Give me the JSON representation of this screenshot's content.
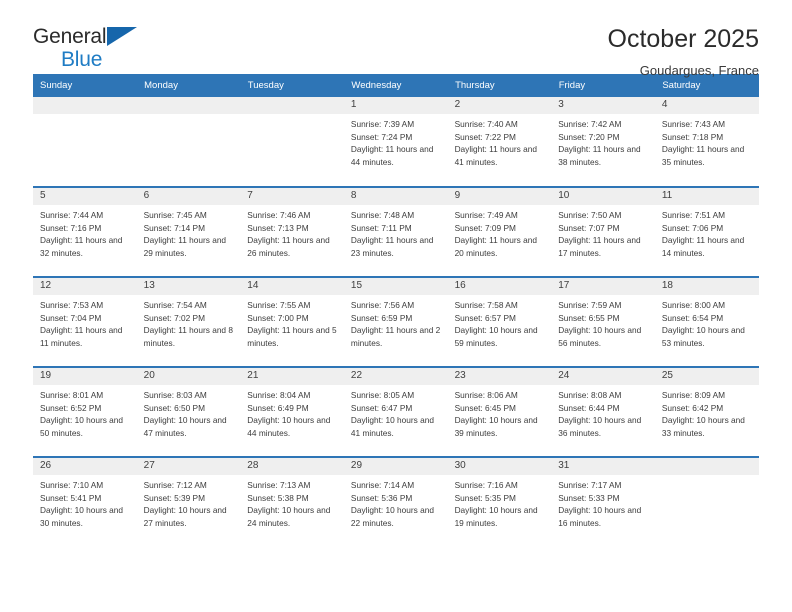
{
  "brand": {
    "name_top": "General",
    "name_bottom": "Blue",
    "triangle_icon": "triangle-icon",
    "accent_color": "#1f7cc4"
  },
  "header": {
    "title": "October 2025",
    "location": "Goudargues, France"
  },
  "theme": {
    "header_blue": "#2e75b6",
    "daynum_band": "#efefef",
    "text": "#3c3c3c"
  },
  "calendar": {
    "weekday_headers": [
      "Sunday",
      "Monday",
      "Tuesday",
      "Wednesday",
      "Thursday",
      "Friday",
      "Saturday"
    ],
    "weeks": [
      [
        {
          "day": "",
          "empty": true
        },
        {
          "day": "",
          "empty": true
        },
        {
          "day": "",
          "empty": true
        },
        {
          "day": "1",
          "sunrise": "Sunrise: 7:39 AM",
          "sunset": "Sunset: 7:24 PM",
          "daylight": "Daylight: 11 hours and 44 minutes."
        },
        {
          "day": "2",
          "sunrise": "Sunrise: 7:40 AM",
          "sunset": "Sunset: 7:22 PM",
          "daylight": "Daylight: 11 hours and 41 minutes."
        },
        {
          "day": "3",
          "sunrise": "Sunrise: 7:42 AM",
          "sunset": "Sunset: 7:20 PM",
          "daylight": "Daylight: 11 hours and 38 minutes."
        },
        {
          "day": "4",
          "sunrise": "Sunrise: 7:43 AM",
          "sunset": "Sunset: 7:18 PM",
          "daylight": "Daylight: 11 hours and 35 minutes."
        }
      ],
      [
        {
          "day": "5",
          "sunrise": "Sunrise: 7:44 AM",
          "sunset": "Sunset: 7:16 PM",
          "daylight": "Daylight: 11 hours and 32 minutes."
        },
        {
          "day": "6",
          "sunrise": "Sunrise: 7:45 AM",
          "sunset": "Sunset: 7:14 PM",
          "daylight": "Daylight: 11 hours and 29 minutes."
        },
        {
          "day": "7",
          "sunrise": "Sunrise: 7:46 AM",
          "sunset": "Sunset: 7:13 PM",
          "daylight": "Daylight: 11 hours and 26 minutes."
        },
        {
          "day": "8",
          "sunrise": "Sunrise: 7:48 AM",
          "sunset": "Sunset: 7:11 PM",
          "daylight": "Daylight: 11 hours and 23 minutes."
        },
        {
          "day": "9",
          "sunrise": "Sunrise: 7:49 AM",
          "sunset": "Sunset: 7:09 PM",
          "daylight": "Daylight: 11 hours and 20 minutes."
        },
        {
          "day": "10",
          "sunrise": "Sunrise: 7:50 AM",
          "sunset": "Sunset: 7:07 PM",
          "daylight": "Daylight: 11 hours and 17 minutes."
        },
        {
          "day": "11",
          "sunrise": "Sunrise: 7:51 AM",
          "sunset": "Sunset: 7:06 PM",
          "daylight": "Daylight: 11 hours and 14 minutes."
        }
      ],
      [
        {
          "day": "12",
          "sunrise": "Sunrise: 7:53 AM",
          "sunset": "Sunset: 7:04 PM",
          "daylight": "Daylight: 11 hours and 11 minutes."
        },
        {
          "day": "13",
          "sunrise": "Sunrise: 7:54 AM",
          "sunset": "Sunset: 7:02 PM",
          "daylight": "Daylight: 11 hours and 8 minutes."
        },
        {
          "day": "14",
          "sunrise": "Sunrise: 7:55 AM",
          "sunset": "Sunset: 7:00 PM",
          "daylight": "Daylight: 11 hours and 5 minutes."
        },
        {
          "day": "15",
          "sunrise": "Sunrise: 7:56 AM",
          "sunset": "Sunset: 6:59 PM",
          "daylight": "Daylight: 11 hours and 2 minutes."
        },
        {
          "day": "16",
          "sunrise": "Sunrise: 7:58 AM",
          "sunset": "Sunset: 6:57 PM",
          "daylight": "Daylight: 10 hours and 59 minutes."
        },
        {
          "day": "17",
          "sunrise": "Sunrise: 7:59 AM",
          "sunset": "Sunset: 6:55 PM",
          "daylight": "Daylight: 10 hours and 56 minutes."
        },
        {
          "day": "18",
          "sunrise": "Sunrise: 8:00 AM",
          "sunset": "Sunset: 6:54 PM",
          "daylight": "Daylight: 10 hours and 53 minutes."
        }
      ],
      [
        {
          "day": "19",
          "sunrise": "Sunrise: 8:01 AM",
          "sunset": "Sunset: 6:52 PM",
          "daylight": "Daylight: 10 hours and 50 minutes."
        },
        {
          "day": "20",
          "sunrise": "Sunrise: 8:03 AM",
          "sunset": "Sunset: 6:50 PM",
          "daylight": "Daylight: 10 hours and 47 minutes."
        },
        {
          "day": "21",
          "sunrise": "Sunrise: 8:04 AM",
          "sunset": "Sunset: 6:49 PM",
          "daylight": "Daylight: 10 hours and 44 minutes."
        },
        {
          "day": "22",
          "sunrise": "Sunrise: 8:05 AM",
          "sunset": "Sunset: 6:47 PM",
          "daylight": "Daylight: 10 hours and 41 minutes."
        },
        {
          "day": "23",
          "sunrise": "Sunrise: 8:06 AM",
          "sunset": "Sunset: 6:45 PM",
          "daylight": "Daylight: 10 hours and 39 minutes."
        },
        {
          "day": "24",
          "sunrise": "Sunrise: 8:08 AM",
          "sunset": "Sunset: 6:44 PM",
          "daylight": "Daylight: 10 hours and 36 minutes."
        },
        {
          "day": "25",
          "sunrise": "Sunrise: 8:09 AM",
          "sunset": "Sunset: 6:42 PM",
          "daylight": "Daylight: 10 hours and 33 minutes."
        }
      ],
      [
        {
          "day": "26",
          "sunrise": "Sunrise: 7:10 AM",
          "sunset": "Sunset: 5:41 PM",
          "daylight": "Daylight: 10 hours and 30 minutes."
        },
        {
          "day": "27",
          "sunrise": "Sunrise: 7:12 AM",
          "sunset": "Sunset: 5:39 PM",
          "daylight": "Daylight: 10 hours and 27 minutes."
        },
        {
          "day": "28",
          "sunrise": "Sunrise: 7:13 AM",
          "sunset": "Sunset: 5:38 PM",
          "daylight": "Daylight: 10 hours and 24 minutes."
        },
        {
          "day": "29",
          "sunrise": "Sunrise: 7:14 AM",
          "sunset": "Sunset: 5:36 PM",
          "daylight": "Daylight: 10 hours and 22 minutes."
        },
        {
          "day": "30",
          "sunrise": "Sunrise: 7:16 AM",
          "sunset": "Sunset: 5:35 PM",
          "daylight": "Daylight: 10 hours and 19 minutes."
        },
        {
          "day": "31",
          "sunrise": "Sunrise: 7:17 AM",
          "sunset": "Sunset: 5:33 PM",
          "daylight": "Daylight: 10 hours and 16 minutes."
        },
        {
          "day": "",
          "empty": true
        }
      ]
    ]
  }
}
